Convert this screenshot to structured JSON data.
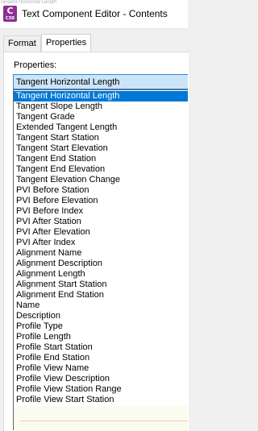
{
  "window": {
    "top_fragment": "Tangent Horizontal Length",
    "icon_label": "C",
    "icon_sublabel": "C3D",
    "title": "Text Component Editor - Contents"
  },
  "tabs": [
    {
      "label": "Format",
      "active": false
    },
    {
      "label": "Properties",
      "active": true
    }
  ],
  "properties": {
    "label": "Properties:",
    "selected_value": "Tangent Horizontal Length",
    "options": [
      "Tangent Horizontal Length",
      "Tangent Slope Length",
      "Tangent Grade",
      "Extended Tangent Length",
      "Tangent Start Station",
      "Tangent Start Elevation",
      "Tangent End Station",
      "Tangent End Elevation",
      "Tangent Elevation Change",
      "PVI Before Station",
      "PVI Before Elevation",
      "PVI Before Index",
      "PVI After Station",
      "PVI After Elevation",
      "PVI After Index",
      "Alignment Name",
      "Alignment Description",
      "Alignment Length",
      "Alignment Start Station",
      "Alignment End Station",
      "Name",
      "Description",
      "Profile Type",
      "Profile Length",
      "Profile Start Station",
      "Profile End Station",
      "Profile View Name",
      "Profile View Description",
      "Profile View Station Range",
      "Profile View Start Station"
    ],
    "selected_index": 0
  },
  "colors": {
    "selection": "#0078d7",
    "combo_highlight": "#cce4f7",
    "icon_purple": "#8e2e93"
  }
}
